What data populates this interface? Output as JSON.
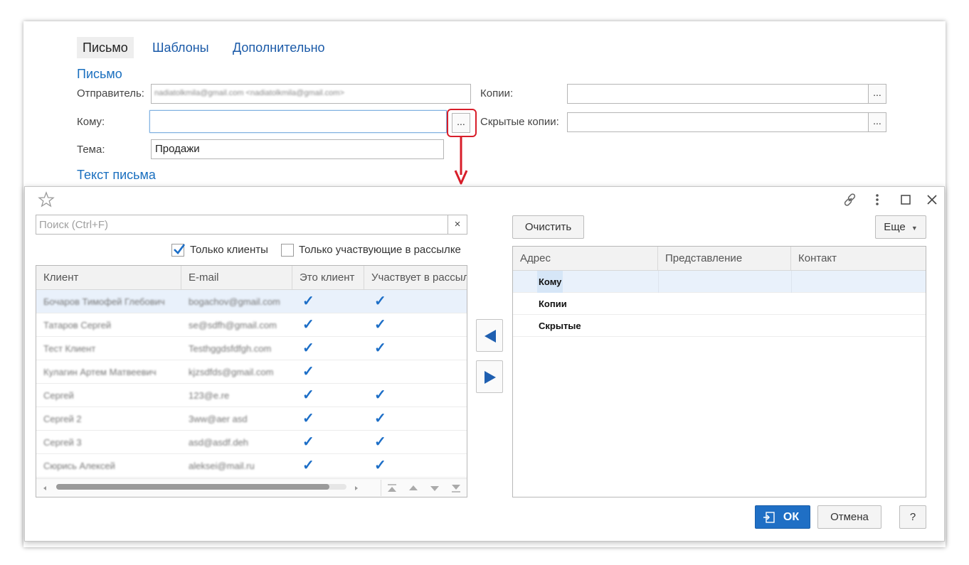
{
  "form": {
    "tabs": [
      {
        "label": "Письмо"
      },
      {
        "label": "Шаблоны"
      },
      {
        "label": "Дополнительно"
      }
    ],
    "section_letter": "Письмо",
    "sender_label": "Отправитель:",
    "sender_value": "nadiatolkmila@gmail.com <nadiatolkmila@gmail.com>",
    "to_label": "Кому:",
    "to_value": "",
    "subject_label": "Тема:",
    "subject_value": "Продажи",
    "cc_label": "Копии:",
    "bcc_label": "Скрытые копии:",
    "dots": "...",
    "section_body": "Текст письма"
  },
  "dialog": {
    "search_placeholder": "Поиск (Ctrl+F)",
    "search_clear": "×",
    "only_clients_label": "Только клиенты",
    "only_clients_checked": true,
    "only_mailing_label": "Только участвующие в рассылке",
    "only_mailing_checked": false,
    "columns": [
      "Клиент",
      "E-mail",
      "Это клиент",
      "Участвует в рассылке"
    ],
    "rows": [
      {
        "client": "Бочаров Тимофей Глебович",
        "email": "bogachov@gmail.com",
        "is_client": true,
        "mailing": true
      },
      {
        "client": "Татаров Сергей",
        "email": "se@sdfh@gmail.com",
        "is_client": true,
        "mailing": true
      },
      {
        "client": "Тест Клиент",
        "email": "Testhggdsfdfgh.com",
        "is_client": true,
        "mailing": true
      },
      {
        "client": "Кулагин Артем Матвеевич",
        "email": "kjzsdfds@gmail.com",
        "is_client": true,
        "mailing": false
      },
      {
        "client": "Сергей",
        "email": "123@e.re",
        "is_client": true,
        "mailing": true
      },
      {
        "client": "Сергей 2",
        "email": "3ww@aer asd",
        "is_client": true,
        "mailing": true
      },
      {
        "client": "Сергей 3",
        "email": "asd@asdf.deh",
        "is_client": true,
        "mailing": true
      },
      {
        "client": "Сюрись Алексей",
        "email": "aleksei@mail.ru",
        "is_client": true,
        "mailing": true
      }
    ],
    "check_glyph": "✓",
    "clear_button": "Очистить",
    "more_button": "Еще",
    "right_columns": [
      "Адрес",
      "Представление",
      "Контакт"
    ],
    "recipient_groups": [
      "Кому",
      "Копии",
      "Скрытые"
    ],
    "ok_button": "ОК",
    "cancel_button": "Отмена",
    "help_button": "?"
  },
  "colors": {
    "accent": "#1f6fc5",
    "link": "#1a5aa8",
    "highlight": "#d81e2a",
    "selection": "#e9f1fb"
  }
}
